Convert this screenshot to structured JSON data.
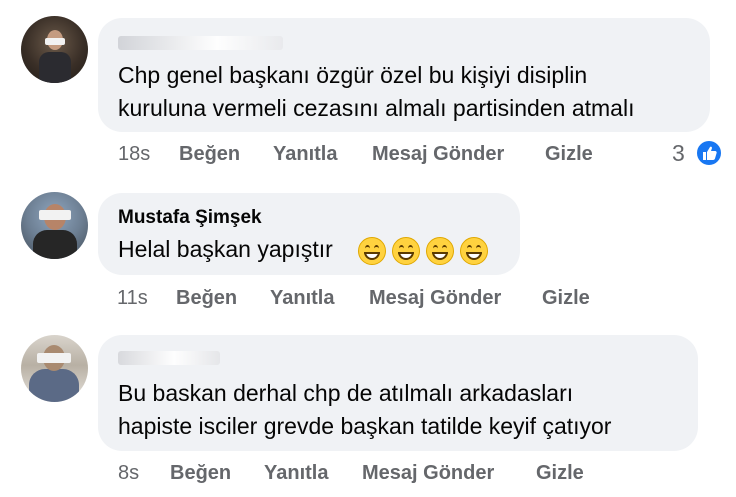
{
  "comments": [
    {
      "author": "",
      "author_redacted": true,
      "text_lines": [
        "Chp genel başkanı özgür özel bu kişiyi disiplin",
        "kuruluna vermeli cezasını almalı partisinden atmalı"
      ],
      "time": "18s",
      "actions": {
        "like": "Beğen",
        "reply": "Yanıtla",
        "message": "Mesaj Gönder",
        "hide": "Gizle"
      },
      "reaction_count": "3",
      "reaction_icon": "like-thumb-icon"
    },
    {
      "author": "Mustafa Şimşek",
      "author_redacted": false,
      "text_lines": [
        "Helal başkan yapıştır"
      ],
      "emoji_count": 4,
      "emoji_icon": "grinning-face-icon",
      "time": "11s",
      "actions": {
        "like": "Beğen",
        "reply": "Yanıtla",
        "message": "Mesaj Gönder",
        "hide": "Gizle"
      }
    },
    {
      "author": "",
      "author_redacted": true,
      "text_lines": [
        "Bu baskan derhal chp de atılmalı arkadasları",
        "hapiste isciler grevde  başkan tatilde keyif çatıyor"
      ],
      "time": "8s",
      "actions": {
        "like": "Beğen",
        "reply": "Yanıtla",
        "message": "Mesaj Gönder",
        "hide": "Gizle"
      }
    }
  ],
  "colors": {
    "bubble": "#f0f2f5",
    "text": "#050505",
    "meta": "#65676b",
    "like_blue": "#1877f2"
  }
}
